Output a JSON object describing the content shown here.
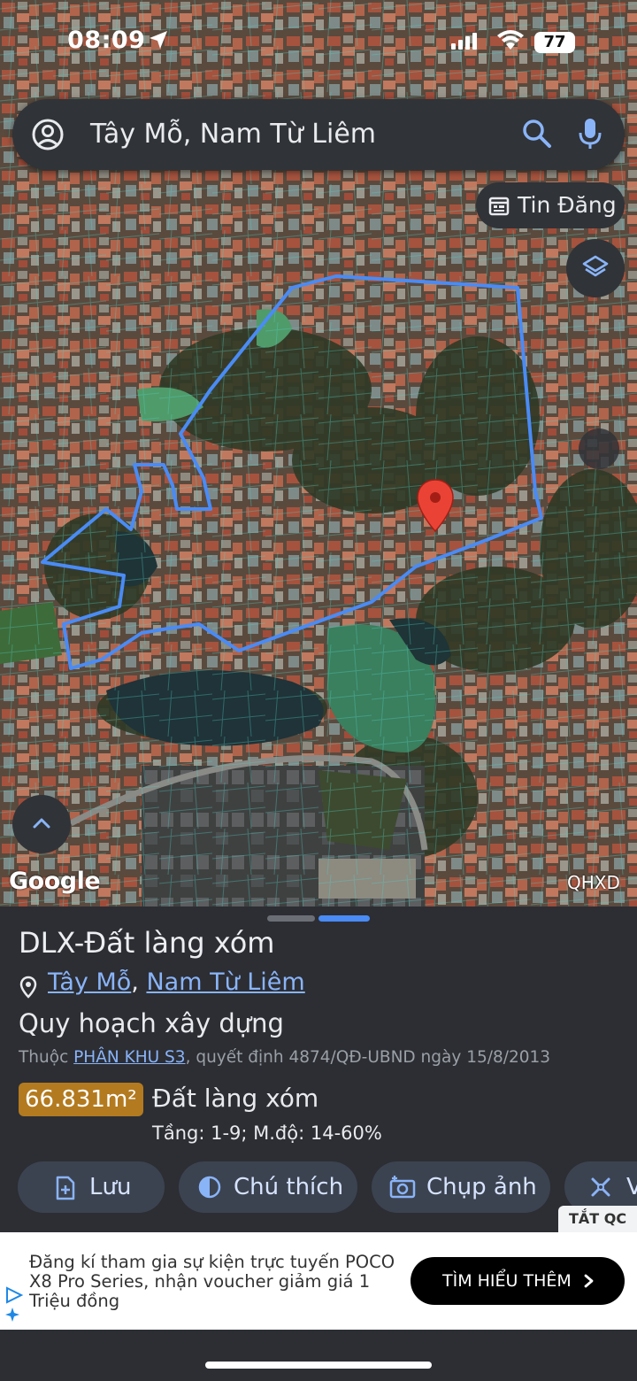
{
  "status_bar": {
    "time": "08:09",
    "battery": "77"
  },
  "search": {
    "query": "Tây Mỗ, Nam Từ Liêm"
  },
  "map": {
    "chip_label": "Tin Đăng",
    "attribution": "Google",
    "layer_name": "QHXD"
  },
  "sheet": {
    "title": "DLX-Đất làng xóm",
    "place": {
      "ward": "Tây Mỗ",
      "separator": ",",
      "district": "Nam Từ Liêm"
    },
    "section": "Quy hoạch xây dựng",
    "belong_prefix": "Thuộc",
    "zone_link": "PHÂN KHU S3",
    "decision": ", quyết định 4874/QĐ-UBND ngày 15/8/2013",
    "area": "66.831m²",
    "land_type": "Đất làng xóm",
    "details": "Tầng: 1-9; M.độ: 14-60%",
    "actions": [
      {
        "label": "Lưu"
      },
      {
        "label": "Chú thích"
      },
      {
        "label": "Chụp ảnh"
      },
      {
        "label": "V"
      }
    ]
  },
  "ad": {
    "tag": "TẮT QC",
    "text": "Đăng kí tham gia sự kiện trực tuyến POCO X8 Pro Series, nhận voucher giảm giá 1 Triệu đồng",
    "cta": "TÌM HIỂU THÊM"
  },
  "colors": {
    "accent": "#8ab4f8",
    "marker": "#ea4335",
    "boundary": "#4a8bf5",
    "area_badge": "#b37a1f"
  }
}
